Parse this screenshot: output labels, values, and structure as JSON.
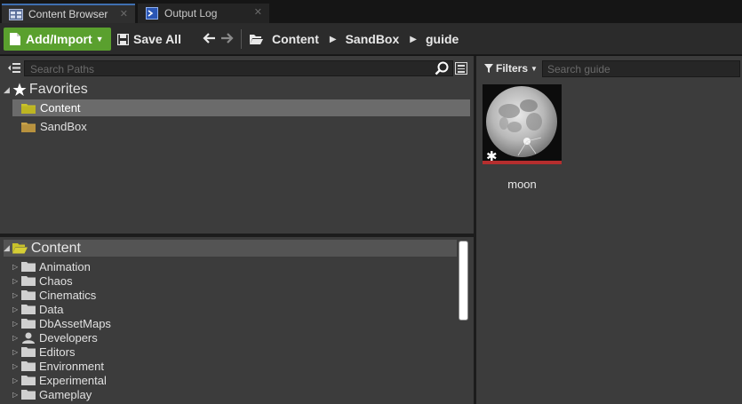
{
  "tabs": [
    {
      "label": "Content Browser",
      "icon": "content-browser-icon"
    },
    {
      "label": "Output Log",
      "icon": "output-log-icon"
    }
  ],
  "toolbar": {
    "add_import_label": "Add/Import",
    "save_all_label": "Save All",
    "breadcrumbs": [
      "Content",
      "SandBox",
      "guide"
    ]
  },
  "sources": {
    "search_placeholder": "Search Paths",
    "favorites_label": "Favorites",
    "favorites": [
      "Content",
      "SandBox"
    ],
    "tree_root": "Content",
    "tree_items": [
      {
        "label": "Animation",
        "icon": "folder-icon"
      },
      {
        "label": "Chaos",
        "icon": "folder-icon"
      },
      {
        "label": "Cinematics",
        "icon": "folder-icon"
      },
      {
        "label": "Data",
        "icon": "folder-icon"
      },
      {
        "label": "DbAssetMaps",
        "icon": "folder-icon"
      },
      {
        "label": "Developers",
        "icon": "user-icon"
      },
      {
        "label": "Editors",
        "icon": "folder-icon"
      },
      {
        "label": "Environment",
        "icon": "folder-icon"
      },
      {
        "label": "Experimental",
        "icon": "folder-icon"
      },
      {
        "label": "Gameplay",
        "icon": "folder-icon"
      }
    ]
  },
  "assets": {
    "filters_label": "Filters",
    "search_placeholder": "Search guide",
    "items": [
      {
        "name": "moon"
      }
    ]
  },
  "colors": {
    "accent_green": "#5aa02e",
    "selected_row": "#6b6b6b",
    "asset_bar": "#b52e2e",
    "folder_yellow": "#c9c22a",
    "folder_tan": "#c8a24a"
  }
}
